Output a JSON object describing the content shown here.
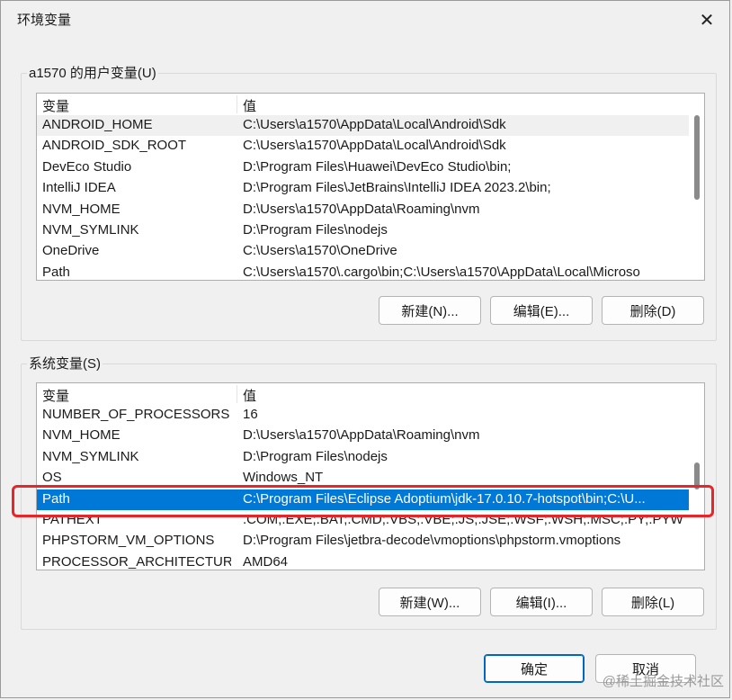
{
  "window": {
    "title": "环境变量",
    "close_icon": "close-icon"
  },
  "user_vars": {
    "legend": "a1570 的用户变量(U)",
    "headers": {
      "name": "变量",
      "value": "值"
    },
    "rows": [
      {
        "name": "ANDROID_HOME",
        "value": "C:\\Users\\a1570\\AppData\\Local\\Android\\Sdk"
      },
      {
        "name": "ANDROID_SDK_ROOT",
        "value": "C:\\Users\\a1570\\AppData\\Local\\Android\\Sdk"
      },
      {
        "name": "DevEco Studio",
        "value": "D:\\Program Files\\Huawei\\DevEco Studio\\bin;"
      },
      {
        "name": "IntelliJ IDEA",
        "value": "D:\\Program Files\\JetBrains\\IntelliJ IDEA 2023.2\\bin;"
      },
      {
        "name": "NVM_HOME",
        "value": "D:\\Users\\a1570\\AppData\\Roaming\\nvm"
      },
      {
        "name": "NVM_SYMLINK",
        "value": "D:\\Program Files\\nodejs"
      },
      {
        "name": "OneDrive",
        "value": "C:\\Users\\a1570\\OneDrive"
      },
      {
        "name": "Path",
        "value": "C:\\Users\\a1570\\.cargo\\bin;C:\\Users\\a1570\\AppData\\Local\\Microso"
      }
    ],
    "buttons": {
      "new": "新建(N)...",
      "edit": "编辑(E)...",
      "delete": "删除(D)"
    }
  },
  "system_vars": {
    "legend": "系统变量(S)",
    "headers": {
      "name": "变量",
      "value": "值"
    },
    "rows": [
      {
        "name": "NUMBER_OF_PROCESSORS",
        "value": "16"
      },
      {
        "name": "NVM_HOME",
        "value": "D:\\Users\\a1570\\AppData\\Roaming\\nvm"
      },
      {
        "name": "NVM_SYMLINK",
        "value": "D:\\Program Files\\nodejs"
      },
      {
        "name": "OS",
        "value": "Windows_NT"
      },
      {
        "name": "Path",
        "value": "C:\\Program Files\\Eclipse Adoptium\\jdk-17.0.10.7-hotspot\\bin;C:\\U...",
        "selected": true
      },
      {
        "name": "PATHEXT",
        "value": ".COM;.EXE;.BAT;.CMD;.VBS;.VBE;.JS;.JSE;.WSF;.WSH;.MSC;.PY;.PYW"
      },
      {
        "name": "PHPSTORM_VM_OPTIONS",
        "value": "D:\\Program Files\\jetbra-decode\\vmoptions\\phpstorm.vmoptions"
      },
      {
        "name": "PROCESSOR_ARCHITECTURE",
        "value": "AMD64"
      }
    ],
    "buttons": {
      "new": "新建(W)...",
      "edit": "编辑(I)...",
      "delete": "删除(L)"
    }
  },
  "footer": {
    "ok": "确定",
    "cancel": "取消"
  },
  "watermark": "@稀土掘金技术社区",
  "colors": {
    "selection": "#0078d7",
    "highlight_box": "#e8262a"
  }
}
